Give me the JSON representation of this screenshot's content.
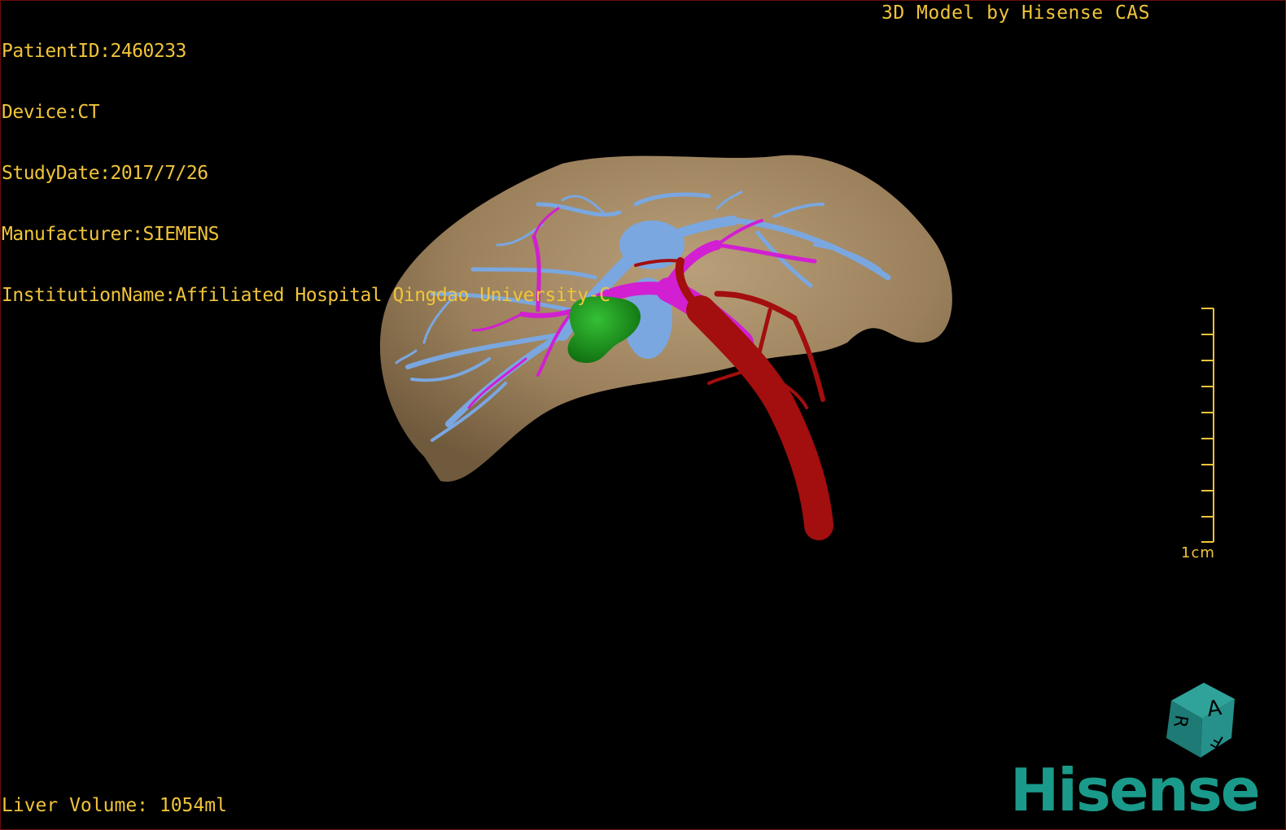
{
  "info": {
    "patient_id": "PatientID:2460233",
    "device": "Device:CT",
    "study_date": "StudyDate:2017/7/26",
    "manufacturer": "Manufacturer:SIEMENS",
    "institution": "InstitutionName:Affiliated Hospital Qingdao University-C"
  },
  "title": "3D Model by Hisense CAS",
  "liver_volume": "Liver Volume: 1054ml",
  "scale": {
    "label": "1cm"
  },
  "orientation_cube": {
    "labels": [
      "A",
      "R",
      "F"
    ]
  },
  "brand": "Hisense",
  "colors": {
    "overlay_text": "#f0c43a",
    "liver": "#b79a72",
    "hepatic_vein": "#7aa7e0",
    "portal_vein": "#d21fd2",
    "artery": "#a30e0e",
    "tumor": "#1a9a1a",
    "brand": "#1a9a8a"
  },
  "icons": [
    "orientation-cube-icon",
    "scale-bar-icon",
    "hisense-logo"
  ]
}
